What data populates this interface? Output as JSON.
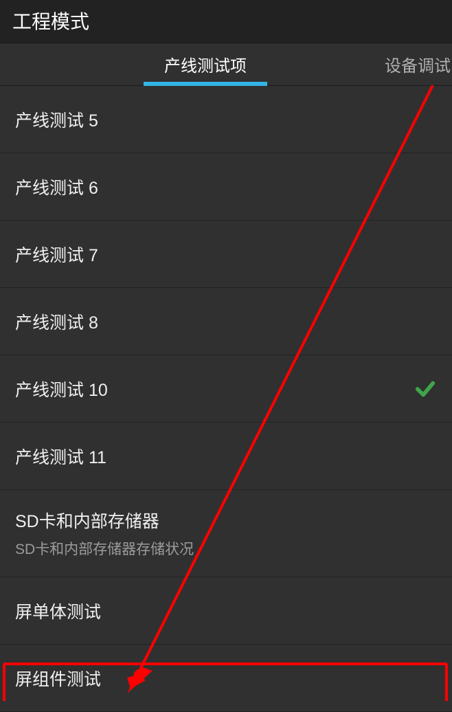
{
  "header": {
    "title": "工程模式"
  },
  "tabs": {
    "active": "产线测试项",
    "right": "设备调试"
  },
  "listItems": [
    {
      "title": "产线测试 5",
      "subtitle": null,
      "checked": false
    },
    {
      "title": "产线测试 6",
      "subtitle": null,
      "checked": false
    },
    {
      "title": "产线测试 7",
      "subtitle": null,
      "checked": false
    },
    {
      "title": "产线测试 8",
      "subtitle": null,
      "checked": false
    },
    {
      "title": "产线测试 10",
      "subtitle": null,
      "checked": true
    },
    {
      "title": "产线测试 11",
      "subtitle": null,
      "checked": false
    },
    {
      "title": "SD卡和内部存储器",
      "subtitle": "SD卡和内部存储器存储状况",
      "checked": false
    },
    {
      "title": "屏单体测试",
      "subtitle": null,
      "checked": false
    },
    {
      "title": "屏组件测试",
      "subtitle": null,
      "checked": false
    }
  ],
  "annotation": {
    "color": "#ff0000"
  }
}
